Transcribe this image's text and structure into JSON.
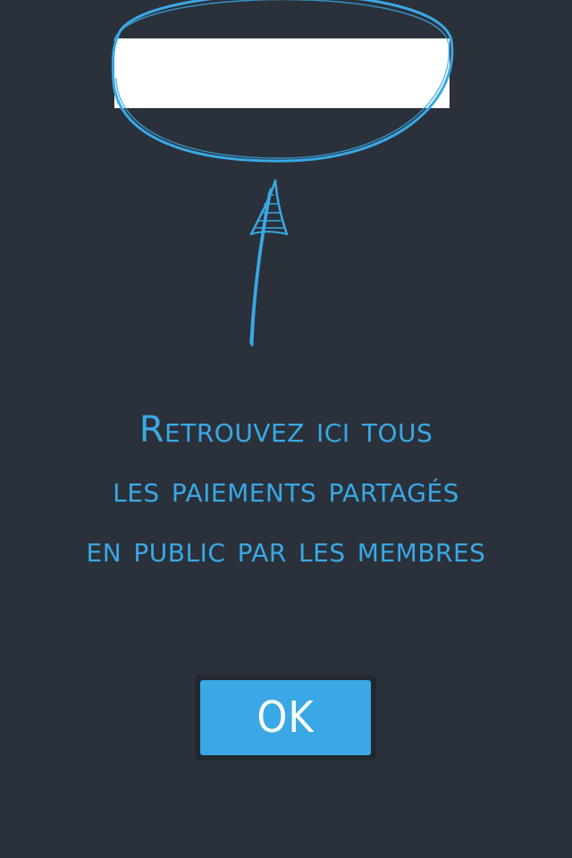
{
  "tutorial": {
    "message_lines": [
      "Retrouvez ici tous",
      "les paiements partagés",
      "en public par les membres"
    ],
    "ok_label": "OK"
  },
  "colors": {
    "background": "#2a313b",
    "accent": "#3aa8e4",
    "highlight": "#ffffff"
  },
  "icons": {
    "annotation_circle": "hand-drawn-circle",
    "annotation_arrow": "hand-drawn-arrow-up"
  }
}
